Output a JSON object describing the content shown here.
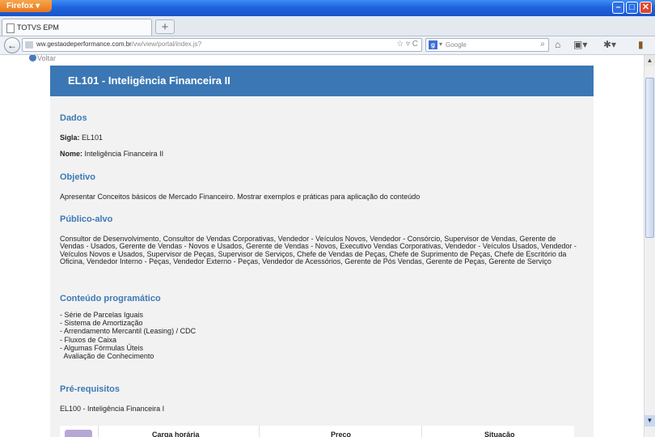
{
  "browser": {
    "app_button": "Firefox",
    "tab_title": "TOTVS EPM",
    "new_tab": "+",
    "url_host": "ww.gestaodeperformance.com.br",
    "url_path": "/vw/view/portal/index.js?",
    "search_engine_label": "Google"
  },
  "page": {
    "back_link": "Voltar",
    "course_title": "EL101 - Inteligência Financeira II",
    "dados": {
      "heading": "Dados",
      "sigla_label": "Sigla:",
      "sigla_value": "EL101",
      "nome_label": "Nome:",
      "nome_value": "Inteligência Financeira II"
    },
    "objetivo": {
      "heading": "Objetivo",
      "text": "Apresentar Conceitos básicos de Mercado Financeiro. Mostrar exemplos e práticas para aplicação do conteúdo"
    },
    "publico_alvo": {
      "heading": "Público-alvo",
      "text": "Consultor de Desenvolvimento, Consultor de Vendas Corporativas, Vendedor - Veículos Novos, Vendedor - Consórcio, Supervisor de Vendas, Gerente de Vendas - Usados, Gerente de Vendas - Novos e Usados, Gerente de Vendas - Novos, Executivo Vendas Corporativas, Vendedor - Veículos Usados, Vendedor - Veículos Novos e Usados, Supervisor de Peças, Supervisor de Serviços, Chefe de Vendas de Peças, Chefe de Suprimento de Peças, Chefe de Escritório da Oficina, Vendedor Interno - Peças, Vendedor Externo - Peças, Vendedor de Acessórios, Gerente de Pós Vendas, Gerente de Peças, Gerente de Serviço"
    },
    "conteudo": {
      "heading": "Conteúdo programático",
      "items": [
        "- Série de Parcelas Iguais",
        "- Sistema de Amortização",
        "- Arrendamento Mercantil (Leasing) / CDC",
        "- Fluxos de Caixa",
        "- Algumas Fórmulas Úteis",
        "  Avaliação de Conhecimento"
      ]
    },
    "prerequisitos": {
      "heading": "Pré-requisitos",
      "text": "EL100 - Inteligência Financeira I"
    },
    "table_headers": {
      "carga": "Carga horária",
      "preco": "Preço",
      "situacao": "Situação"
    }
  }
}
